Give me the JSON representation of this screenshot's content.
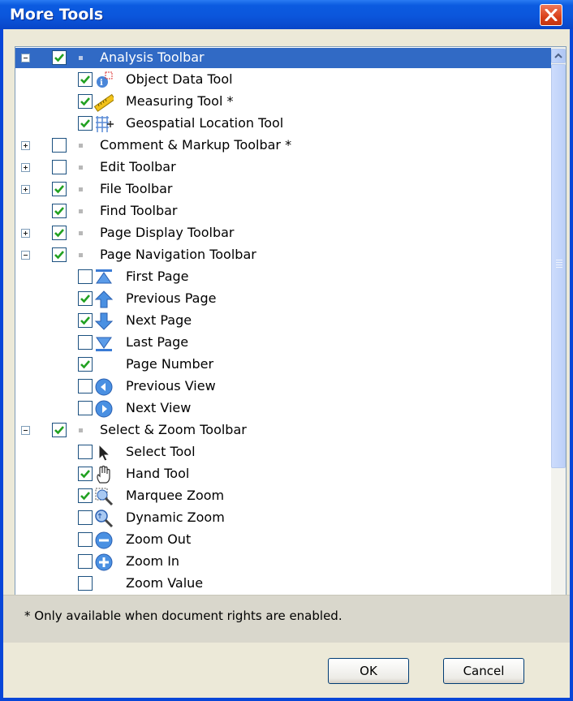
{
  "window": {
    "title": "More Tools",
    "footnote": "* Only available when document rights are enabled.",
    "ok_label": "OK",
    "cancel_label": "Cancel"
  },
  "tree": {
    "items": [
      {
        "label": "Analysis Toolbar",
        "level": 0,
        "expander": "minus",
        "checked": true,
        "selected": true,
        "icon": "bullet"
      },
      {
        "label": "Object Data Tool",
        "level": 1,
        "checked": true,
        "icon": "object-data-icon"
      },
      {
        "label": "Measuring Tool *",
        "level": 1,
        "checked": true,
        "icon": "ruler-icon"
      },
      {
        "label": "Geospatial Location Tool",
        "level": 1,
        "checked": true,
        "icon": "geospatial-grid-icon"
      },
      {
        "label": "Comment & Markup Toolbar *",
        "level": 0,
        "expander": "plus",
        "checked": false,
        "icon": "bullet"
      },
      {
        "label": "Edit Toolbar",
        "level": 0,
        "expander": "plus",
        "checked": false,
        "icon": "bullet"
      },
      {
        "label": "File Toolbar",
        "level": 0,
        "expander": "plus",
        "checked": true,
        "icon": "bullet"
      },
      {
        "label": "Find Toolbar",
        "level": 0,
        "expander": "none",
        "checked": true,
        "icon": "bullet"
      },
      {
        "label": "Page Display Toolbar",
        "level": 0,
        "expander": "plus",
        "checked": true,
        "icon": "bullet"
      },
      {
        "label": "Page Navigation Toolbar",
        "level": 0,
        "expander": "minus",
        "checked": true,
        "icon": "bullet"
      },
      {
        "label": "First Page",
        "level": 1,
        "checked": false,
        "icon": "first-page-icon"
      },
      {
        "label": "Previous Page",
        "level": 1,
        "checked": true,
        "icon": "previous-page-icon"
      },
      {
        "label": "Next Page",
        "level": 1,
        "checked": true,
        "icon": "next-page-icon"
      },
      {
        "label": "Last Page",
        "level": 1,
        "checked": false,
        "icon": "last-page-icon"
      },
      {
        "label": "Page Number",
        "level": 1,
        "checked": true,
        "icon": "none"
      },
      {
        "label": "Previous View",
        "level": 1,
        "checked": false,
        "icon": "previous-view-icon"
      },
      {
        "label": "Next View",
        "level": 1,
        "checked": false,
        "icon": "next-view-icon"
      },
      {
        "label": "Select & Zoom Toolbar",
        "level": 0,
        "expander": "minus",
        "checked": true,
        "icon": "bullet"
      },
      {
        "label": "Select Tool",
        "level": 1,
        "checked": false,
        "icon": "arrow-cursor-icon"
      },
      {
        "label": "Hand Tool",
        "level": 1,
        "checked": true,
        "icon": "hand-icon"
      },
      {
        "label": "Marquee Zoom",
        "level": 1,
        "checked": true,
        "icon": "marquee-zoom-icon"
      },
      {
        "label": "Dynamic Zoom",
        "level": 1,
        "checked": false,
        "icon": "dynamic-zoom-icon"
      },
      {
        "label": "Zoom Out",
        "level": 1,
        "checked": false,
        "icon": "zoom-out-icon"
      },
      {
        "label": "Zoom In",
        "level": 1,
        "checked": false,
        "icon": "zoom-in-icon"
      },
      {
        "label": "Zoom Value",
        "level": 1,
        "checked": false,
        "icon": "none"
      }
    ]
  },
  "colors": {
    "titlebar": "#0b56dc",
    "selection": "#316ac5",
    "check": "#21a121",
    "dialog_bg": "#ece9d8"
  }
}
